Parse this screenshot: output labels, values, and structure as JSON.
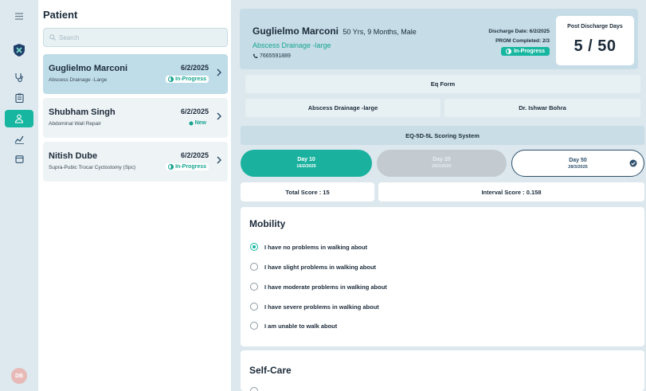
{
  "rail": {
    "items": [
      "menu-icon",
      "shield-logo-icon",
      "stethoscope-icon",
      "clipboard-icon",
      "patients-icon",
      "analytics-icon",
      "calendar-icon"
    ],
    "avatar_initials": "DB"
  },
  "patient_list": {
    "title": "Patient",
    "search_placeholder": "Search",
    "patients": [
      {
        "name": "Guglielmo Marconi",
        "procedure": "Abscess Drainage -Large",
        "date": "6/2/2025",
        "status": "In-Progress"
      },
      {
        "name": "Shubham Singh",
        "procedure": "Abdominal Wall Repair",
        "date": "6/2/2025",
        "status": "New"
      },
      {
        "name": "Nitish Dube",
        "procedure": "Supra-Pubic Trocar Cyctostomy (Spc)",
        "date": "6/2/2025",
        "status": "In-Progress"
      }
    ]
  },
  "header": {
    "name": "Guglielmo Marconi",
    "age": "50 Yrs, 9 Months, Male",
    "procedure": "Abscess Drainage -large",
    "phone": "7665591889",
    "discharge_date": "Discharge Date: 6/2/2025",
    "prom": "PROM Completed: 2/3",
    "status": "In-Progress",
    "post_discharge_label": "Post Discharge Days",
    "post_discharge_value": "5 / 50"
  },
  "form": {
    "title": "Eq Form",
    "procedure": "Abscess Drainage -large",
    "doctor": "Dr. Ishwar Bohra",
    "scoring_system": "EQ-5D-5L Scoring System"
  },
  "days": [
    {
      "title": "Day 10",
      "date": "16/2/2025"
    },
    {
      "title": "Day 20",
      "date": "26/2/2025"
    },
    {
      "title": "Day 50",
      "date": "28/3/2025"
    }
  ],
  "scores": {
    "total": "Total Score : 15",
    "interval": "Interval Score : 0.158"
  },
  "questions": {
    "mobility": {
      "title": "Mobility",
      "options": [
        "I have no problems in walking about",
        "I have slight problems in walking about",
        "I have moderate problems in walking about",
        "I have severe problems in walking about",
        "I am unable to walk about"
      ],
      "selected_index": 0
    },
    "self_care": {
      "title": "Self-Care"
    }
  },
  "colors": {
    "accent": "#16b6a0",
    "selected_card": "#bfdde8",
    "panel_bg": "#dce8ee"
  }
}
